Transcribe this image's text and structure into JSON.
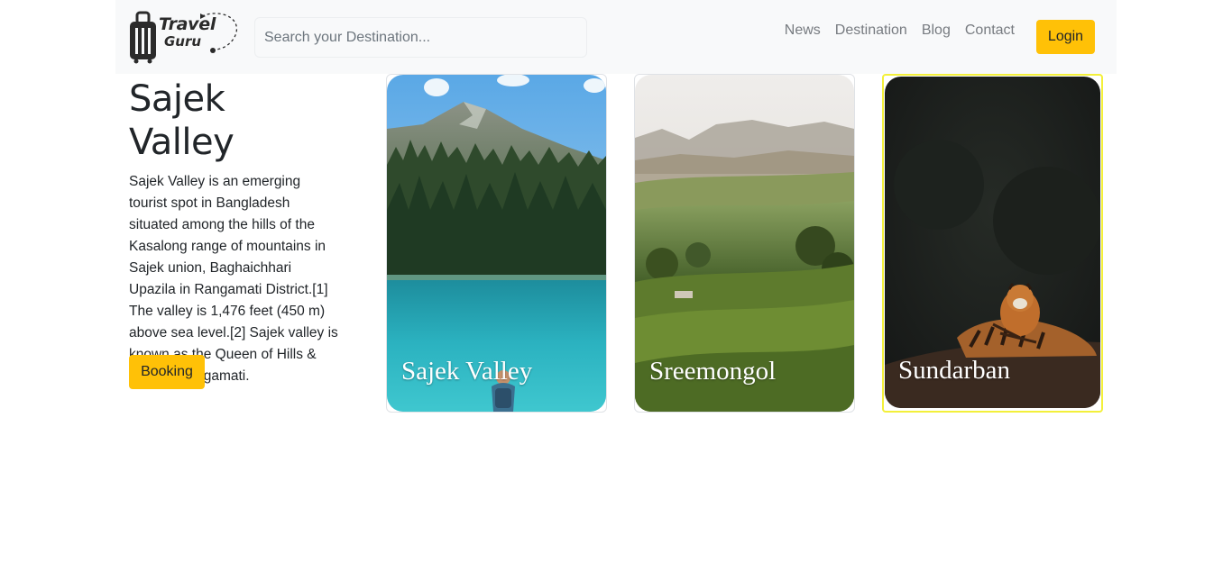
{
  "brand": {
    "line1": "Travel",
    "line2": "Guru",
    "icon": "suitcase-icon"
  },
  "search": {
    "placeholder": "Search your Destination..."
  },
  "nav": {
    "links": [
      "News",
      "Destination",
      "Blog",
      "Contact"
    ],
    "login_label": "Login"
  },
  "hero": {
    "title": "Sajek Valley",
    "description": "Sajek Valley is an emerging tourist spot in Bangladesh situated among the hills of the Kasalong range of mountains in Sajek union, Baghaichhari Upazila in Rangamati District.[1] The valley is 1,476 feet (450 m) above sea level.[2] Sajek valley is known as the Queen of Hills & Roof of Rangamati.",
    "booking_label": "Booking"
  },
  "cards": [
    {
      "title": "Sajek Valley",
      "image": "mountain-lake-forest-hiker"
    },
    {
      "title": "Sreemongol",
      "image": "green-tea-hills"
    },
    {
      "title": "Sundarban",
      "image": "tiger-dark-forest"
    }
  ],
  "colors": {
    "accent": "#ffc107",
    "navbar_bg": "#f8f9fa",
    "selected_border": "#f3f03a"
  }
}
